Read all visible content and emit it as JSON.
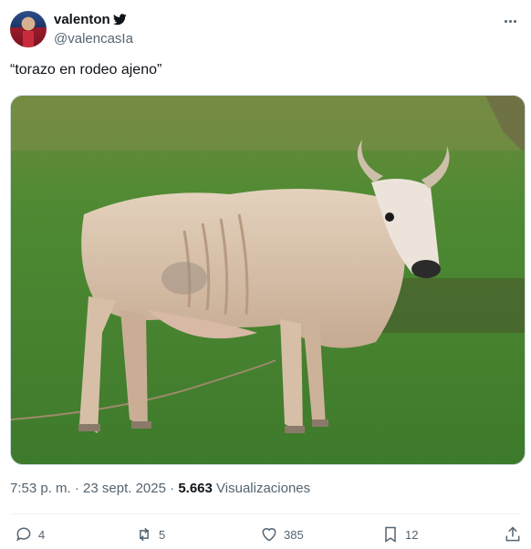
{
  "user": {
    "display_name": "valenton",
    "handle": "@valencasIa",
    "badge_icon": "twitter-bird-icon"
  },
  "tweet": {
    "text": "“torazo en rodeo ajeno”",
    "media_description": "photo",
    "time": "7:53 p. m.",
    "separator": "·",
    "date": "23 sept. 2025",
    "views_count": "5.663",
    "views_label": "Visualizaciones"
  },
  "actions": {
    "replies": "4",
    "retweets": "5",
    "likes": "385",
    "bookmarks": "12"
  },
  "colors": {
    "text": "#0f1419",
    "secondary": "#536471",
    "border": "#cfd9de"
  }
}
